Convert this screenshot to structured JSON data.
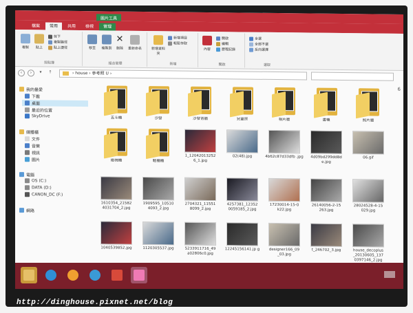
{
  "ribbon": {
    "picture_tools_label": "圖片工具",
    "tabs": [
      {
        "label": "檔案",
        "active": false
      },
      {
        "label": "常用",
        "active": true
      },
      {
        "label": "共用",
        "active": false
      },
      {
        "label": "檢視",
        "active": false
      },
      {
        "label": "管理",
        "active": false
      }
    ],
    "clipboard": {
      "copy": "複製",
      "paste": "貼上",
      "cut": "剪下",
      "copy_path": "複製路徑",
      "paste_shortcut": "貼上捷徑",
      "group_label": "剪貼簿"
    },
    "organize": {
      "move_to": "移至",
      "copy_to": "複製到",
      "delete": "刪除",
      "rename": "重新命名",
      "group_label": "組合管理"
    },
    "new": {
      "new_folder": "新增資料夾",
      "new_item": "新增項目",
      "easy_access": "輕鬆存取",
      "group_label": "新增"
    },
    "open": {
      "properties": "內容",
      "open": "開啟",
      "edit": "編輯",
      "history": "歷程記錄",
      "group_label": "開啟"
    },
    "select": {
      "select_all": "全選",
      "select_none": "全部不選",
      "invert": "反向選擇",
      "group_label": "選取"
    }
  },
  "address": {
    "path": "› house › 參考照 U ›"
  },
  "nav": {
    "favorites": "我的最愛",
    "downloads": "下載",
    "desktop": "桌面",
    "recent": "最近的位置",
    "skydrive": "SkyDrive",
    "libraries": "媒體櫃",
    "docs": "文件",
    "music": "音樂",
    "videos": "視訊",
    "pictures": "圖片",
    "computer": "電腦",
    "drive_c": "OS (C:)",
    "drive_d": "DATA (D:)",
    "drive_f": "CANON_DC (F:)",
    "network": "網路"
  },
  "items": [
    {
      "name": "五斗櫃",
      "kind": "folder"
    },
    {
      "name": "沙發",
      "kind": "folder"
    },
    {
      "name": "沙發背牆",
      "kind": "folder"
    },
    {
      "name": "兒童房",
      "kind": "folder"
    },
    {
      "name": "相片牆",
      "kind": "folder"
    },
    {
      "name": "書櫃",
      "kind": "folder"
    },
    {
      "name": "照片牆",
      "kind": "folder"
    },
    {
      "name": "衛視櫃",
      "kind": "folder"
    },
    {
      "name": "鞋櫃櫃",
      "kind": "folder"
    },
    {
      "name": "1_12042013252 6_1.jpg",
      "kind": "photo"
    },
    {
      "name": "02(48).jpg",
      "kind": "photo"
    },
    {
      "name": "4b62c87d33dfb .jpg",
      "kind": "photo"
    },
    {
      "name": "4d09bd299dd8d e.jpg",
      "kind": "photo"
    },
    {
      "name": "06.gif",
      "kind": "photo"
    },
    {
      "name": "1610354_21582 4031704_2.jpg",
      "kind": "photo"
    },
    {
      "name": "1909595_10510 4093_2.jpg",
      "kind": "photo"
    },
    {
      "name": "2704321_11551 8099_2.jpg",
      "kind": "photo"
    },
    {
      "name": "4257381_12352 0059185_2.jpg",
      "kind": "photo"
    },
    {
      "name": "17230014-15-0 k22.jpg",
      "kind": "photo"
    },
    {
      "name": "26140056-2-15 263.jpg",
      "kind": "photo"
    },
    {
      "name": "28024528-4-15 029.jpg",
      "kind": "photo"
    },
    {
      "name": "1040539852.jpg",
      "kind": "photo"
    },
    {
      "name": "1120305537.jpg",
      "kind": "photo"
    },
    {
      "name": "5233911716_49 a02806c0.jpg",
      "kind": "photo"
    },
    {
      "name": "12245156141.jp g",
      "kind": "photo"
    },
    {
      "name": "designer166_09 _03.jpg",
      "kind": "photo"
    },
    {
      "name": "t_246702_3.jpg",
      "kind": "photo"
    },
    {
      "name": "house_decoplus _20130605_137 0397146_2.jpg",
      "kind": "photo"
    }
  ],
  "edge_text": "6",
  "watermark": "http://dinghouse.pixnet.net/blog"
}
